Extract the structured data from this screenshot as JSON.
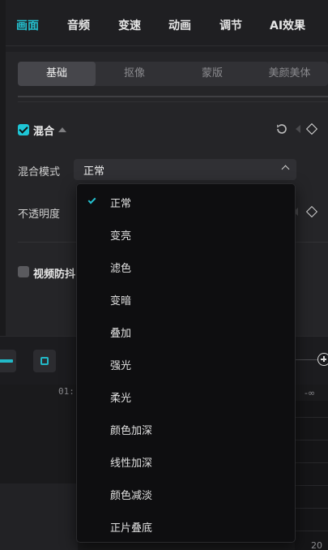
{
  "tabs": [
    {
      "label": "画面",
      "active": true
    },
    {
      "label": "音频"
    },
    {
      "label": "变速"
    },
    {
      "label": "动画"
    },
    {
      "label": "调节"
    },
    {
      "label": "AI效果"
    }
  ],
  "subtabs": [
    {
      "label": "基础",
      "active": true
    },
    {
      "label": "抠像"
    },
    {
      "label": "蒙版"
    },
    {
      "label": "美颜美体"
    }
  ],
  "mix_section": {
    "title": "混合",
    "checked": true,
    "blend_mode_label": "混合模式",
    "blend_mode_value": "正常",
    "opacity_label": "不透明度"
  },
  "stabilize_section": {
    "title": "视频防抖",
    "checked": false
  },
  "dropdown": {
    "selected": "正常",
    "options": [
      "正常",
      "变亮",
      "滤色",
      "变暗",
      "叠加",
      "强光",
      "柔光",
      "颜色加深",
      "线性加深",
      "颜色减淡",
      "正片叠底"
    ]
  },
  "timeline": {
    "ruler_label": "01:",
    "ruler_end": "-∞",
    "right_number": "20"
  },
  "colors": {
    "accent": "#24c0cf",
    "panel_bg": "#252528",
    "menu_bg": "#0e0e10"
  }
}
